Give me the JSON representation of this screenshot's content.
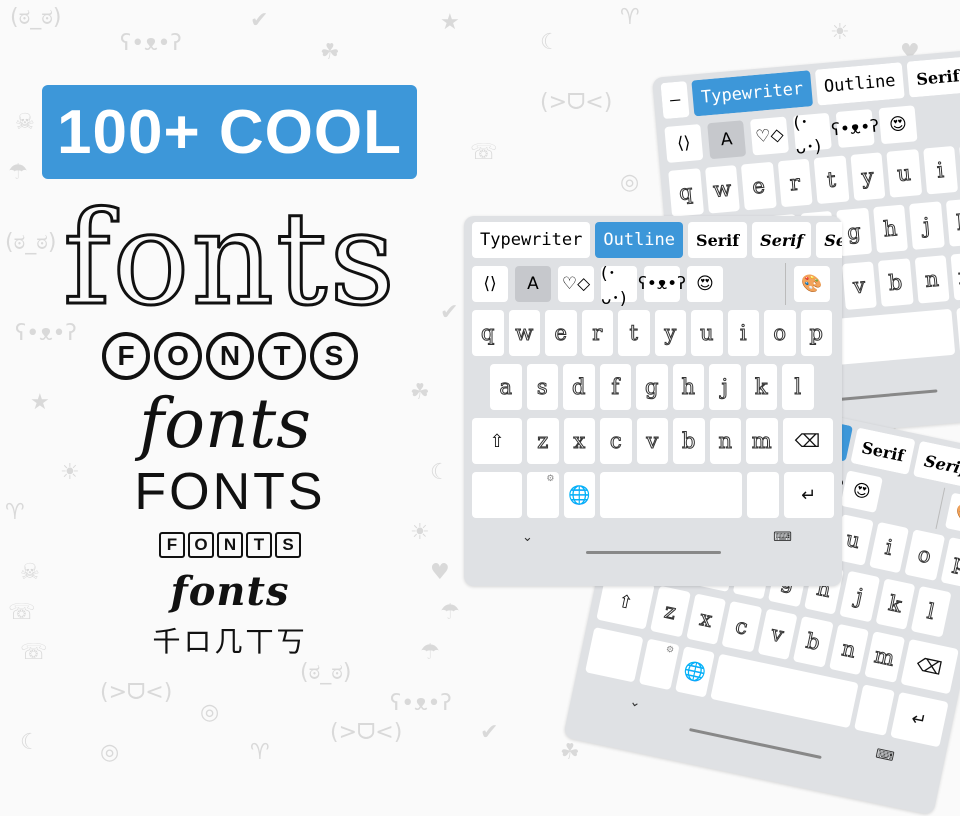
{
  "headline": "100+ COOL",
  "samples": {
    "outline": "fonts",
    "circled": [
      "F",
      "O",
      "N",
      "T",
      "S"
    ],
    "italic_serif": "fonts",
    "curly": "FONTS",
    "boxed": [
      "F",
      "O",
      "N",
      "T",
      "S"
    ],
    "blackletter": "fonts",
    "asian_style": "千ロ几丅丂"
  },
  "background_symbols": [
    "(ಠ_ಠ)",
    "ʕ•ᴥ•ʔ",
    "✔",
    "☘",
    "★",
    "☾",
    "♈",
    "☀",
    "♥",
    "☠",
    "☂",
    "☏",
    "(>ᗜ<)",
    "◎"
  ],
  "keyboard": {
    "tabs": [
      "Typewriter",
      "Outline",
      "Serif",
      "Serif",
      "Serif"
    ],
    "active_tab": "Outline",
    "tools": [
      {
        "icon": "share-icon",
        "glyph": "⟨⟩"
      },
      {
        "icon": "font-style-icon",
        "glyph": "A"
      },
      {
        "icon": "symbols-icon",
        "glyph": "♡◇"
      },
      {
        "icon": "kaomoji-icon",
        "glyph": "(･ᴗ･)"
      },
      {
        "icon": "bear-sticker-icon",
        "glyph": "ʕ•ᴥ•ʔ"
      },
      {
        "icon": "emoji-icon",
        "glyph": "😍"
      }
    ],
    "palette_icon": "palette-icon",
    "rows": [
      [
        "q",
        "w",
        "e",
        "r",
        "t",
        "y",
        "u",
        "i",
        "o",
        "p"
      ],
      [
        "a",
        "s",
        "d",
        "f",
        "g",
        "h",
        "j",
        "k",
        "l"
      ],
      [
        "z",
        "x",
        "c",
        "v",
        "b",
        "n",
        "m"
      ]
    ],
    "shift_glyph": "⇧",
    "backspace_glyph": "⌫",
    "enter_glyph": "↵",
    "globe_glyph": "🌐",
    "collapse_glyph": "⌄",
    "keyboard_switch_glyph": "⌨"
  },
  "back_keyboard": {
    "tabs": [
      "–",
      "Typewriter",
      "Outline",
      "Serif",
      "Serif"
    ],
    "active_tab": "Typewriter"
  },
  "colors": {
    "accent": "#3d97d9",
    "keyboard_bg": "#dfe1e4",
    "background": "#fafafa"
  }
}
